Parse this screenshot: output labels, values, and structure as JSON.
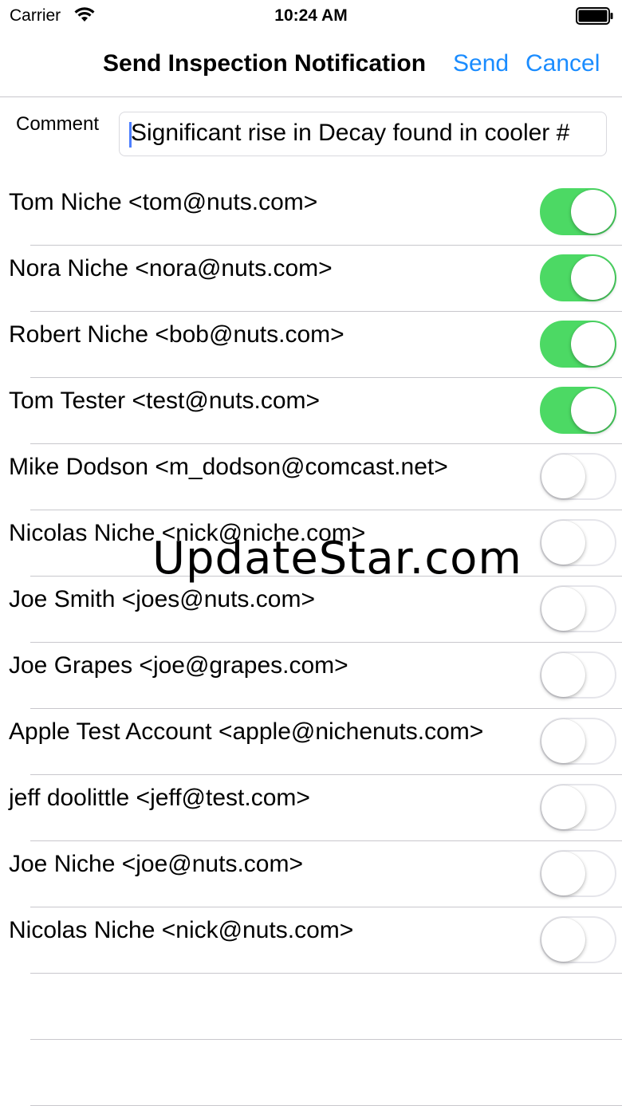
{
  "status_bar": {
    "carrier": "Carrier",
    "time": "10:24 AM",
    "wifi_icon": "wifi-icon",
    "battery_icon": "battery-full-icon"
  },
  "nav": {
    "title": "Send Inspection Notification",
    "send_label": "Send",
    "cancel_label": "Cancel",
    "accent_color": "#1a8cff"
  },
  "comment": {
    "label": "Comment",
    "value": "Significant rise in Decay found in cooler #"
  },
  "contacts": [
    {
      "label": "Tom Niche <tom@nuts.com>",
      "enabled": true
    },
    {
      "label": "Nora Niche <nora@nuts.com>",
      "enabled": true
    },
    {
      "label": "Robert Niche <bob@nuts.com>",
      "enabled": true
    },
    {
      "label": "Tom Tester <test@nuts.com>",
      "enabled": true
    },
    {
      "label": "Mike Dodson <m_dodson@comcast.net>",
      "enabled": false
    },
    {
      "label": "Nicolas Niche <nick@niche.com>",
      "enabled": false
    },
    {
      "label": "Joe Smith <joes@nuts.com>",
      "enabled": false
    },
    {
      "label": "Joe Grapes <joe@grapes.com>",
      "enabled": false
    },
    {
      "label": "Apple Test Account <apple@nichenuts.com>",
      "enabled": false
    },
    {
      "label": "jeff doolittle <jeff@test.com>",
      "enabled": false
    },
    {
      "label": "Joe Niche <joe@nuts.com>",
      "enabled": false
    },
    {
      "label": "Nicolas Niche <nick@nuts.com>",
      "enabled": false
    }
  ],
  "toggle_on_color": "#4cd964",
  "watermark": "UpdateStar.com"
}
